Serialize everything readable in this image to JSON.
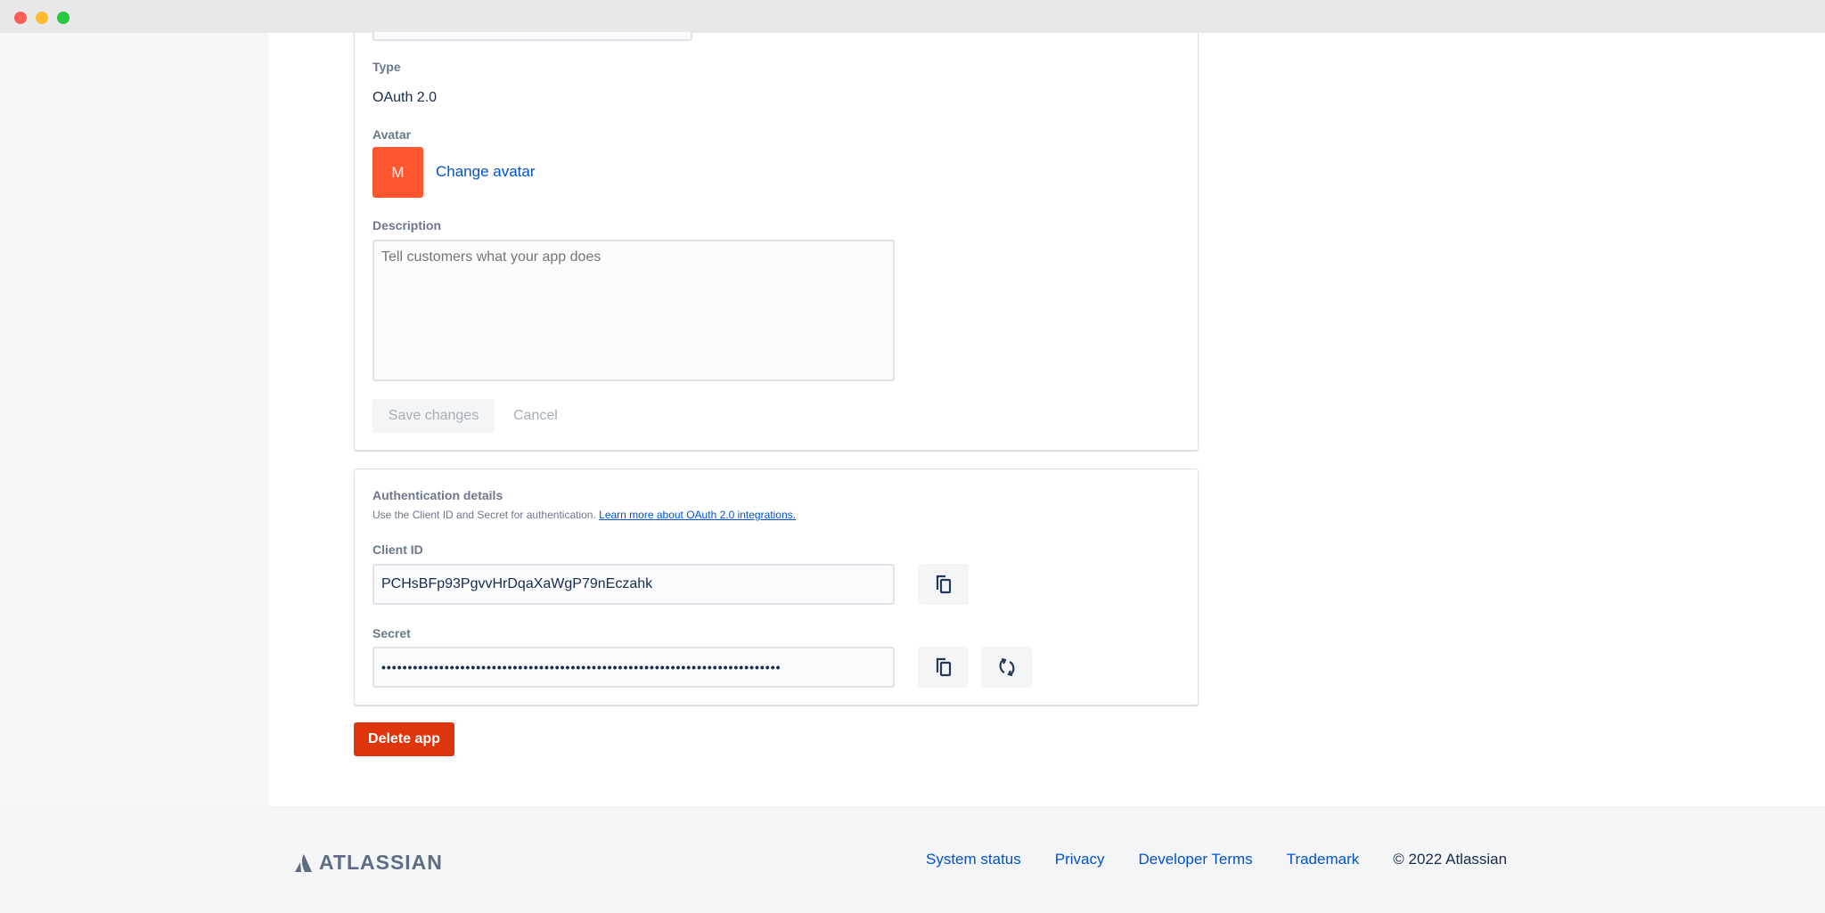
{
  "window": {
    "controls": [
      "close",
      "minimize",
      "maximize"
    ]
  },
  "app_details": {
    "type_label": "Type",
    "type_value": "OAuth 2.0",
    "avatar_label": "Avatar",
    "avatar_initial": "M",
    "avatar_color": "#FF5630",
    "change_avatar_label": "Change avatar",
    "description_label": "Description",
    "description_value": "",
    "description_placeholder": "Tell customers what your app does",
    "save_label": "Save changes",
    "cancel_label": "Cancel"
  },
  "auth": {
    "title": "Authentication details",
    "description": "Use the Client ID and Secret for authentication.",
    "learn_more_link": "Learn more about OAuth 2.0 integrations.",
    "client_id_label": "Client ID",
    "client_id_value": "PCHsBFp93PgvvHrDqaXaWgP79nEczahk",
    "secret_label": "Secret",
    "secret_masked": "••••••••••••••••••••••••••••••••••••••••••••••••••••••••••••••••••••••••••••",
    "copy_icon": "copy-icon",
    "regenerate_icon": "refresh-icon"
  },
  "delete_label": "Delete app",
  "delete_color": "#DE350B",
  "footer": {
    "logo_text": "ATLASSIAN",
    "links": [
      "System status",
      "Privacy",
      "Developer Terms",
      "Trademark"
    ],
    "copyright": "© 2022 Atlassian"
  },
  "colors": {
    "link": "#0052CC",
    "label": "#6B778C",
    "text": "#172B4D"
  }
}
